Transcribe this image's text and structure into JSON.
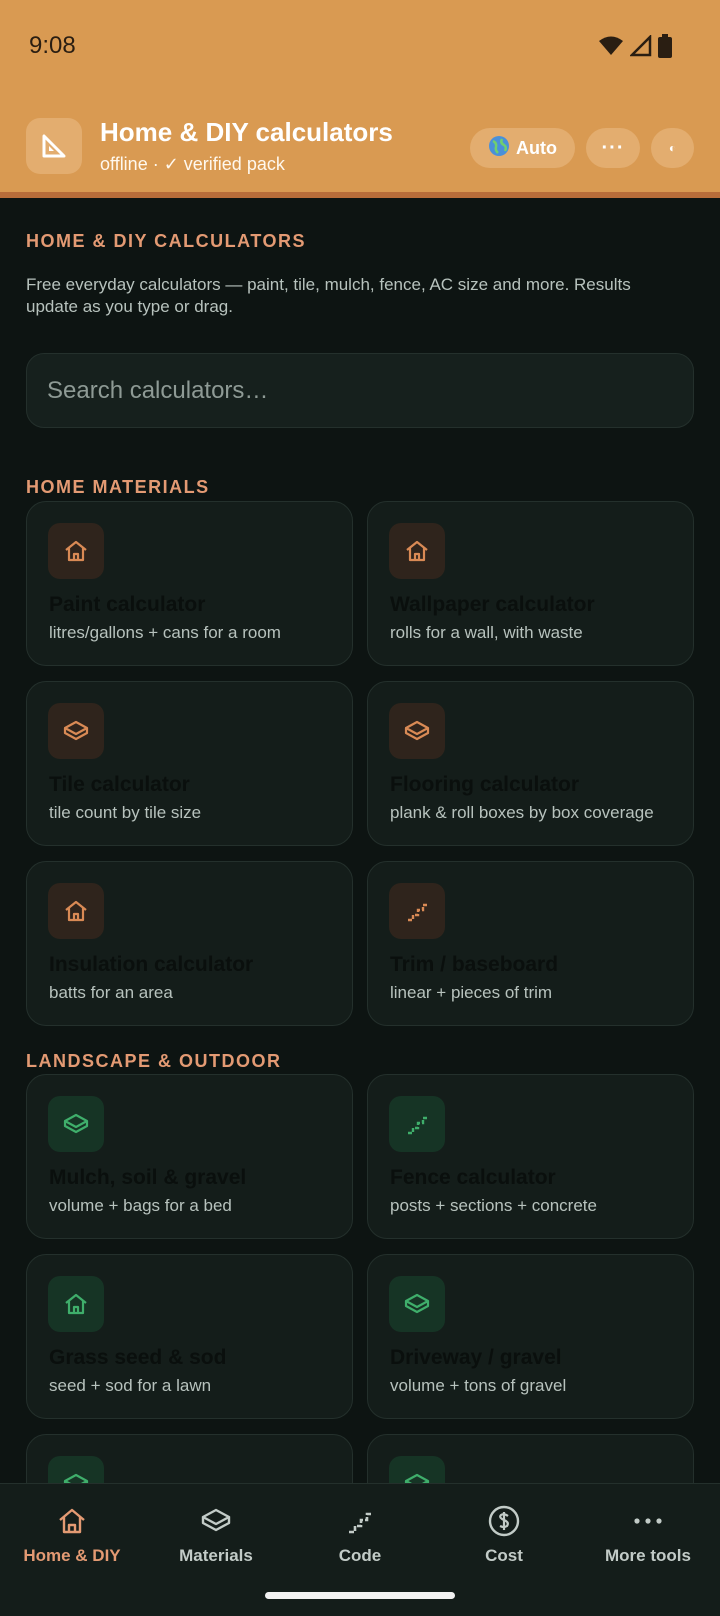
{
  "status": {
    "time": "9:08"
  },
  "header": {
    "title": "Home & DIY calculators",
    "subtitle": "offline · ✓ verified pack",
    "language_button": "Auto",
    "more_button": "···",
    "theme_button": "◐"
  },
  "intro": {
    "heading": "HOME & DIY CALCULATORS",
    "description": "Free everyday calculators — paint, tile, mulch, fence, AC size and more. Results update as you type or drag."
  },
  "search": {
    "placeholder": "Search calculators…",
    "value": ""
  },
  "sections": {
    "home": {
      "heading": "HOME MATERIALS",
      "cards": [
        {
          "title": "Paint calculator",
          "subtitle": "litres/gallons + cans for a room",
          "icon": "house-icon"
        },
        {
          "title": "Wallpaper calculator",
          "subtitle": "rolls for a wall, with waste",
          "icon": "house-icon"
        },
        {
          "title": "Tile calculator",
          "subtitle": "tile count by tile size",
          "icon": "layers-icon"
        },
        {
          "title": "Flooring calculator",
          "subtitle": "plank & roll boxes by box coverage",
          "icon": "layers-icon"
        },
        {
          "title": "Insulation calculator",
          "subtitle": "batts for an area",
          "icon": "house-icon"
        },
        {
          "title": "Trim / baseboard",
          "subtitle": "linear + pieces of trim",
          "icon": "stairs-icon"
        }
      ]
    },
    "landscape": {
      "heading": "LANDSCAPE & OUTDOOR",
      "cards": [
        {
          "title": "Mulch, soil & gravel",
          "subtitle": "volume + bags for a bed",
          "icon": "layers-icon"
        },
        {
          "title": "Fence calculator",
          "subtitle": "posts + sections + concrete",
          "icon": "stairs-icon"
        },
        {
          "title": "Grass seed & sod",
          "subtitle": "seed + sod for a lawn",
          "icon": "house-icon"
        },
        {
          "title": "Driveway / gravel",
          "subtitle": "volume + tons of gravel",
          "icon": "layers-icon"
        }
      ]
    }
  },
  "nav": [
    {
      "label": "Home & DIY",
      "icon": "house-icon",
      "active": true
    },
    {
      "label": "Materials",
      "icon": "layers-icon",
      "active": false
    },
    {
      "label": "Code",
      "icon": "stairs-icon",
      "active": false
    },
    {
      "label": "Cost",
      "icon": "dollar-coin-icon",
      "active": false
    },
    {
      "label": "More tools",
      "icon": "dots-icon",
      "active": false
    }
  ],
  "colors": {
    "header_bg": "#d99a52",
    "accent": "#e39a73",
    "home_icon": "#d98a55",
    "landscape_icon": "#3fae6b",
    "background": "#0d1412"
  }
}
